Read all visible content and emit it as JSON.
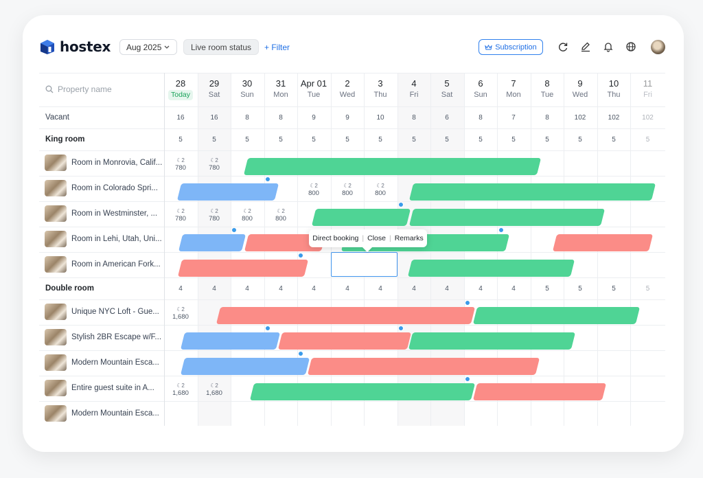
{
  "brand": {
    "name": "hostex",
    "accent": "#1f6fe5"
  },
  "toolbar": {
    "month": "Aug 2025",
    "live_status": "Live room status",
    "filter": "+ Filter",
    "subscription": "Subscription",
    "icons": [
      "refresh-icon",
      "edit-icon",
      "bell-icon",
      "globe-icon"
    ]
  },
  "search": {
    "placeholder": "Property name"
  },
  "days": [
    {
      "num": "28",
      "name": "Today"
    },
    {
      "num": "29",
      "name": "Sat"
    },
    {
      "num": "30",
      "name": "Sun"
    },
    {
      "num": "31",
      "name": "Mon"
    },
    {
      "num": "Apr 01",
      "name": "Tue"
    },
    {
      "num": "2",
      "name": "Wed"
    },
    {
      "num": "3",
      "name": "Thu"
    },
    {
      "num": "4",
      "name": "Fri"
    },
    {
      "num": "5",
      "name": "Sat"
    },
    {
      "num": "6",
      "name": "Sun"
    },
    {
      "num": "7",
      "name": "Mon"
    },
    {
      "num": "8",
      "name": "Tue"
    },
    {
      "num": "9",
      "name": "Wed"
    },
    {
      "num": "10",
      "name": "Thu"
    },
    {
      "num": "11",
      "name": "Fri"
    }
  ],
  "vacant": {
    "label": "Vacant",
    "values": [
      "16",
      "16",
      "8",
      "8",
      "9",
      "9",
      "10",
      "8",
      "6",
      "8",
      "7",
      "8",
      "102",
      "102",
      "102"
    ]
  },
  "groups": [
    {
      "name": "King room",
      "values": [
        "5",
        "5",
        "5",
        "5",
        "5",
        "5",
        "5",
        "5",
        "5",
        "5",
        "5",
        "5",
        "5",
        "5",
        "5"
      ]
    },
    {
      "name": "Double room",
      "values": [
        "4",
        "4",
        "4",
        "4",
        "4",
        "4",
        "4",
        "4",
        "4",
        "4",
        "4",
        "5",
        "5",
        "5",
        "5"
      ]
    }
  ],
  "properties": [
    "Room in Monrovia, Calif...",
    "Room in Colorado Spri...",
    "Room in Westminster, ...",
    "Room in Lehi, Utah, Uni...",
    "Room in American Fork...",
    "Unique NYC Loft - Gue...",
    "Stylish 2BR Escape w/F...",
    "Modern Mountain Esca...",
    "Entire guest suite in A...",
    "Modern Mountain Esca..."
  ],
  "prices": {
    "moon": "☾2",
    "p780": "780",
    "p800": "800",
    "p1680": "1,680"
  },
  "tooltip": {
    "a": "Direct booking",
    "b": "Close",
    "c": "Remarks"
  },
  "colors": {
    "green": "#4fd495",
    "blue": "#7eb6f7",
    "red": "#fb8c87",
    "today": "#1aa35a"
  }
}
